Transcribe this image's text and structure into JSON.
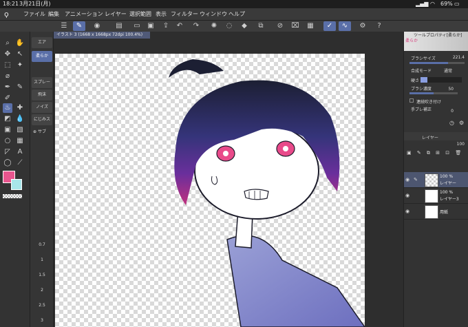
{
  "status": {
    "time": "18:21",
    "date": "3月21日(月)",
    "battery": "69%"
  },
  "menu": [
    "ファイル",
    "編集",
    "アニメーション",
    "レイヤー",
    "選択範囲",
    "表示",
    "フィルター",
    "ウィンドウ",
    "ヘルプ"
  ],
  "document": {
    "tab_label": "イラスト 3 (1668 x 1668px 72dpi 100.4%)"
  },
  "subtools": {
    "items": [
      "エア",
      "柔らか",
      "スプレー",
      "飛沫",
      "ノイズ",
      "にじみス",
      "サブ"
    ]
  },
  "zoom_scale": [
    "0.7",
    "1",
    "1.5",
    "2",
    "2.5",
    "3"
  ],
  "tool_property": {
    "title": "ツールプロパティ[柔らか]",
    "preset_name": "柔らか",
    "brush_size_label": "ブラシサイズ",
    "brush_size_value": "221.4",
    "blend_mode_label": "合成モード",
    "blend_mode_value": "通常",
    "hardness_label": "硬さ",
    "density_label": "ブラシ濃度",
    "density_value": "50",
    "continuous_label": "連続吹き付け",
    "stabilization_label": "手ブレ補正",
    "stabilization_value": "0"
  },
  "layers": {
    "title": "レイヤー",
    "opacity": "100",
    "items": [
      {
        "pct": "100 %",
        "name": "レイヤー"
      },
      {
        "pct": "100 %",
        "name": "レイヤー3"
      },
      {
        "pct": "",
        "name": "用紙"
      }
    ]
  },
  "colors": {
    "main": "#e8558e",
    "sub": "#a8e6ea",
    "accent": "#5a6fa8"
  }
}
